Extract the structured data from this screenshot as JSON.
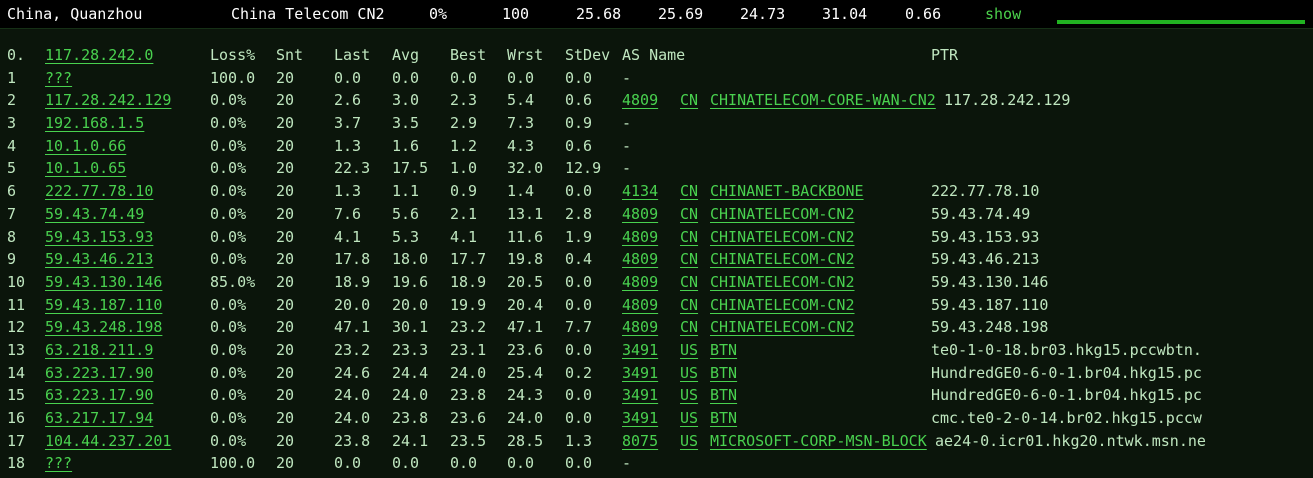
{
  "summary": {
    "location": "China, Quanzhou",
    "carrier": "China Telecom CN2",
    "loss": "0%",
    "sent": "100",
    "last": "25.68",
    "avg": "25.69",
    "best": "24.73",
    "worst": "31.04",
    "stdev": "0.66",
    "show_label": "show"
  },
  "headers": {
    "idx": "0.",
    "host": "117.28.242.0",
    "loss": "Loss%",
    "snt": "Snt",
    "last": "Last",
    "avg": "Avg",
    "best": "Best",
    "wrst": "Wrst",
    "stdev": "StDev",
    "as_name": "AS Name",
    "ptr": "PTR"
  },
  "rows": [
    {
      "idx": "1",
      "host": "???",
      "loss": "100.0",
      "snt": "20",
      "last": "0.0",
      "avg": "0.0",
      "best": "0.0",
      "wrst": "0.0",
      "stdev": "0.0",
      "asn": "",
      "cc": "",
      "as_name": "-",
      "ptr": ""
    },
    {
      "idx": "2",
      "host": "117.28.242.129",
      "loss": "0.0%",
      "snt": "20",
      "last": "2.6",
      "avg": "3.0",
      "best": "2.3",
      "wrst": "5.4",
      "stdev": "0.6",
      "asn": "4809",
      "cc": "CN",
      "as_name": "CHINATELECOM-CORE-WAN-CN2",
      "ptr": "117.28.242.129"
    },
    {
      "idx": "3",
      "host": "192.168.1.5",
      "loss": "0.0%",
      "snt": "20",
      "last": "3.7",
      "avg": "3.5",
      "best": "2.9",
      "wrst": "7.3",
      "stdev": "0.9",
      "asn": "",
      "cc": "",
      "as_name": "-",
      "ptr": ""
    },
    {
      "idx": "4",
      "host": "10.1.0.66",
      "loss": "0.0%",
      "snt": "20",
      "last": "1.3",
      "avg": "1.6",
      "best": "1.2",
      "wrst": "4.3",
      "stdev": "0.6",
      "asn": "",
      "cc": "",
      "as_name": "-",
      "ptr": ""
    },
    {
      "idx": "5",
      "host": "10.1.0.65",
      "loss": "0.0%",
      "snt": "20",
      "last": "22.3",
      "avg": "17.5",
      "best": "1.0",
      "wrst": "32.0",
      "stdev": "12.9",
      "asn": "",
      "cc": "",
      "as_name": "-",
      "ptr": ""
    },
    {
      "idx": "6",
      "host": "222.77.78.10",
      "loss": "0.0%",
      "snt": "20",
      "last": "1.3",
      "avg": "1.1",
      "best": "0.9",
      "wrst": "1.4",
      "stdev": "0.0",
      "asn": "4134",
      "cc": "CN",
      "as_name": "CHINANET-BACKBONE",
      "ptr": "222.77.78.10"
    },
    {
      "idx": "7",
      "host": "59.43.74.49",
      "loss": "0.0%",
      "snt": "20",
      "last": "7.6",
      "avg": "5.6",
      "best": "2.1",
      "wrst": "13.1",
      "stdev": "2.8",
      "asn": "4809",
      "cc": "CN",
      "as_name": "CHINATELECOM-CN2",
      "ptr": "59.43.74.49"
    },
    {
      "idx": "8",
      "host": "59.43.153.93",
      "loss": "0.0%",
      "snt": "20",
      "last": "4.1",
      "avg": "5.3",
      "best": "4.1",
      "wrst": "11.6",
      "stdev": "1.9",
      "asn": "4809",
      "cc": "CN",
      "as_name": "CHINATELECOM-CN2",
      "ptr": "59.43.153.93"
    },
    {
      "idx": "9",
      "host": "59.43.46.213",
      "loss": "0.0%",
      "snt": "20",
      "last": "17.8",
      "avg": "18.0",
      "best": "17.7",
      "wrst": "19.8",
      "stdev": "0.4",
      "asn": "4809",
      "cc": "CN",
      "as_name": "CHINATELECOM-CN2",
      "ptr": "59.43.46.213"
    },
    {
      "idx": "10",
      "host": "59.43.130.146",
      "loss": "85.0%",
      "snt": "20",
      "last": "18.9",
      "avg": "19.6",
      "best": "18.9",
      "wrst": "20.5",
      "stdev": "0.0",
      "asn": "4809",
      "cc": "CN",
      "as_name": "CHINATELECOM-CN2",
      "ptr": "59.43.130.146"
    },
    {
      "idx": "11",
      "host": "59.43.187.110",
      "loss": "0.0%",
      "snt": "20",
      "last": "20.0",
      "avg": "20.0",
      "best": "19.9",
      "wrst": "20.4",
      "stdev": "0.0",
      "asn": "4809",
      "cc": "CN",
      "as_name": "CHINATELECOM-CN2",
      "ptr": "59.43.187.110"
    },
    {
      "idx": "12",
      "host": "59.43.248.198",
      "loss": "0.0%",
      "snt": "20",
      "last": "47.1",
      "avg": "30.1",
      "best": "23.2",
      "wrst": "47.1",
      "stdev": "7.7",
      "asn": "4809",
      "cc": "CN",
      "as_name": "CHINATELECOM-CN2",
      "ptr": "59.43.248.198"
    },
    {
      "idx": "13",
      "host": "63.218.211.9",
      "loss": "0.0%",
      "snt": "20",
      "last": "23.2",
      "avg": "23.3",
      "best": "23.1",
      "wrst": "23.6",
      "stdev": "0.0",
      "asn": "3491",
      "cc": "US",
      "as_name": "BTN",
      "ptr": "te0-1-0-18.br03.hkg15.pccwbtn."
    },
    {
      "idx": "14",
      "host": "63.223.17.90",
      "loss": "0.0%",
      "snt": "20",
      "last": "24.6",
      "avg": "24.4",
      "best": "24.0",
      "wrst": "25.4",
      "stdev": "0.2",
      "asn": "3491",
      "cc": "US",
      "as_name": "BTN",
      "ptr": "HundredGE0-6-0-1.br04.hkg15.pc"
    },
    {
      "idx": "15",
      "host": "63.223.17.90",
      "loss": "0.0%",
      "snt": "20",
      "last": "24.0",
      "avg": "24.0",
      "best": "23.8",
      "wrst": "24.3",
      "stdev": "0.0",
      "asn": "3491",
      "cc": "US",
      "as_name": "BTN",
      "ptr": "HundredGE0-6-0-1.br04.hkg15.pc"
    },
    {
      "idx": "16",
      "host": "63.217.17.94",
      "loss": "0.0%",
      "snt": "20",
      "last": "24.0",
      "avg": "23.8",
      "best": "23.6",
      "wrst": "24.0",
      "stdev": "0.0",
      "asn": "3491",
      "cc": "US",
      "as_name": "BTN",
      "ptr": "cmc.te0-2-0-14.br02.hkg15.pccw"
    },
    {
      "idx": "17",
      "host": "104.44.237.201",
      "loss": "0.0%",
      "snt": "20",
      "last": "23.8",
      "avg": "24.1",
      "best": "23.5",
      "wrst": "28.5",
      "stdev": "1.3",
      "asn": "8075",
      "cc": "US",
      "as_name": "MICROSOFT-CORP-MSN-BLOCK",
      "ptr": "ae24-0.icr01.hkg20.ntwk.msn.ne"
    },
    {
      "idx": "18",
      "host": "???",
      "loss": "100.0",
      "snt": "20",
      "last": "0.0",
      "avg": "0.0",
      "best": "0.0",
      "wrst": "0.0",
      "stdev": "0.0",
      "asn": "",
      "cc": "",
      "as_name": "-",
      "ptr": ""
    }
  ]
}
